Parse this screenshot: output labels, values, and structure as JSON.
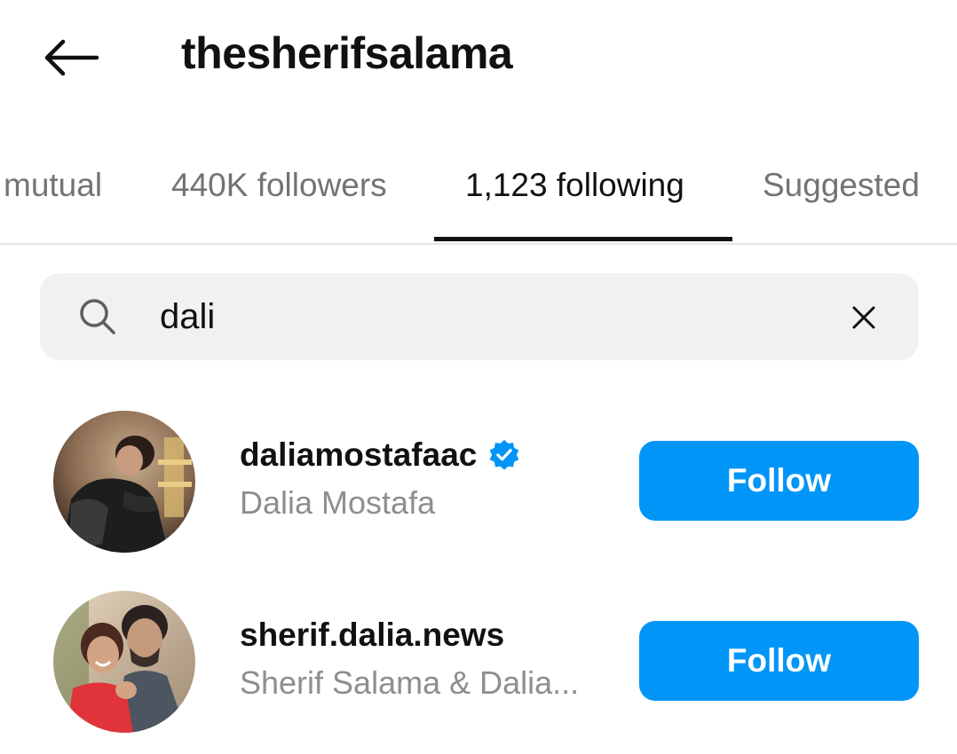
{
  "header": {
    "back_icon": "arrow-left-icon",
    "title": "thesherifsalama"
  },
  "tabs": [
    {
      "label": "mutual",
      "active": false
    },
    {
      "label": "440K followers",
      "active": false
    },
    {
      "label": "1,123 following",
      "active": true
    },
    {
      "label": "Suggested",
      "active": false
    }
  ],
  "search": {
    "icon": "search-icon",
    "value": "dali",
    "clear_icon": "close-icon"
  },
  "results": [
    {
      "username": "daliamostafaac",
      "verified": true,
      "full_name": "Dalia Mostafa",
      "button_label": "Follow"
    },
    {
      "username": "sherif.dalia.news",
      "verified": false,
      "full_name": "Sherif Salama & Dalia...",
      "button_label": "Follow"
    }
  ],
  "colors": {
    "accent": "#0095f6",
    "verified_badge": "#0095f6",
    "secondary_text": "#8e8e8e"
  }
}
